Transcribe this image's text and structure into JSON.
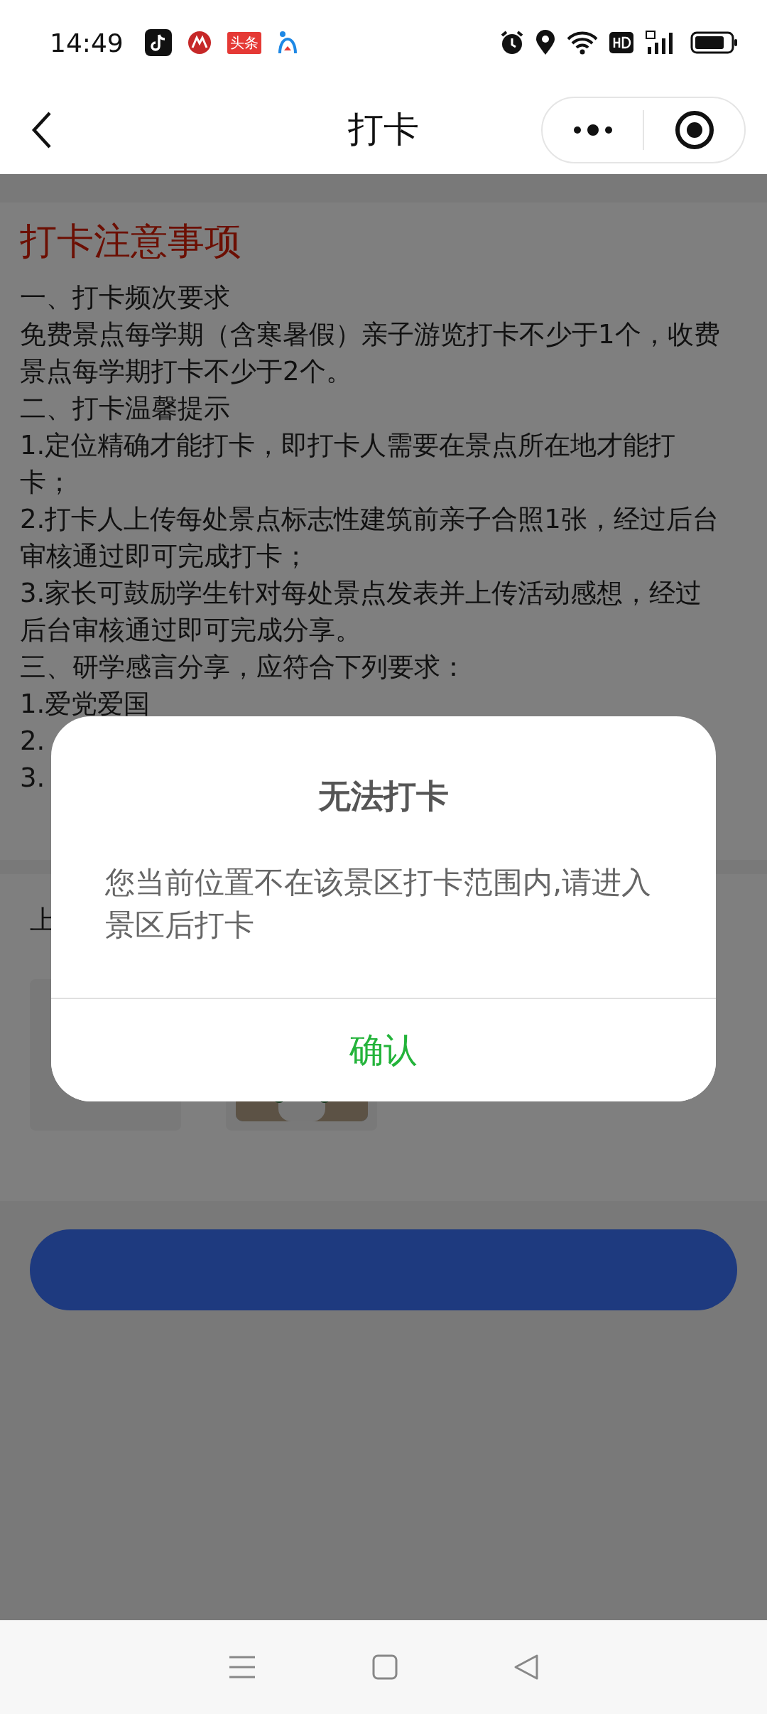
{
  "status_bar": {
    "time": "14:49",
    "app_badge": "头条"
  },
  "nav": {
    "title": "打卡"
  },
  "notice": {
    "title": "打卡注意事项",
    "lines": [
      "一、打卡频次要求",
      "免费景点每学期（含寒暑假）亲子游览打卡不少于1个，收费景点每学期打卡不少于2个。",
      "二、打卡温馨提示",
      "1.定位精确才能打卡，即打卡人需要在景点所在地才能打卡；",
      "2.打卡人上传每处景点标志性建筑前亲子合照1张，经过后台审核通过即可完成打卡；",
      "3.家长可鼓励学生针对每处景点发表并上传活动感想，经过后台审核通过即可完成分享。",
      "三、研学感言分享，应符合下列要求：",
      "1.爱党爱国",
      "2.",
      "3."
    ]
  },
  "upload": {
    "label": "上",
    "tiles": [
      {
        "kind": "empty"
      },
      {
        "kind": "picture"
      }
    ]
  },
  "dialog": {
    "title": "无法打卡",
    "message": "您当前位置不在该景区打卡范围内,请进入景区后打卡",
    "confirm": "确认"
  }
}
